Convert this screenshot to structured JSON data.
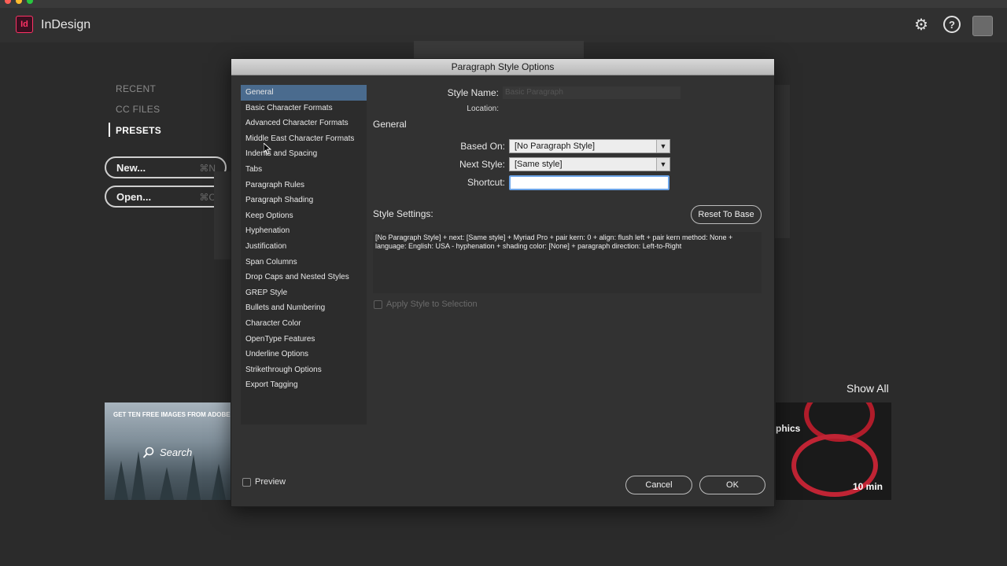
{
  "app": {
    "name": "InDesign",
    "logo": "Id"
  },
  "start": {
    "nav": {
      "recent": "RECENT",
      "cc_files": "CC FILES",
      "presets": "PRESETS"
    },
    "new_label": "New...",
    "new_key": "⌘N",
    "open_label": "Open...",
    "open_key": "⌘C",
    "show_all": "Show All",
    "tile_left_caption": "GET TEN FREE IMAGES FROM ADOBE ST",
    "tile_left_search": "Search",
    "tile_right_text": "phics",
    "tile_right_time": "10 min"
  },
  "dialog": {
    "title": "Paragraph Style Options",
    "categories": [
      "General",
      "Basic Character Formats",
      "Advanced Character Formats",
      "Middle East Character Formats",
      "Indents and Spacing",
      "Tabs",
      "Paragraph Rules",
      "Paragraph Shading",
      "Keep Options",
      "Hyphenation",
      "Justification",
      "Span Columns",
      "Drop Caps and Nested Styles",
      "GREP Style",
      "Bullets and Numbering",
      "Character Color",
      "OpenType Features",
      "Underline Options",
      "Strikethrough Options",
      "Export Tagging"
    ],
    "style_name_label": "Style Name:",
    "style_name_value": "Basic Paragraph",
    "location_label": "Location:",
    "section_title": "General",
    "based_on_label": "Based On:",
    "based_on_value": "[No Paragraph Style]",
    "next_style_label": "Next Style:",
    "next_style_value": "[Same style]",
    "shortcut_label": "Shortcut:",
    "shortcut_value": "",
    "style_settings_label": "Style Settings:",
    "reset_label": "Reset To Base",
    "settings_text": "[No Paragraph Style] + next: [Same style] + Myriad Pro + pair kern: 0 + align: flush left + pair kern method: None + language: English: USA - hyphenation + shading color: [None] + paragraph direction: Left-to-Right",
    "apply_label": "Apply Style to Selection",
    "preview_label": "Preview",
    "cancel_label": "Cancel",
    "ok_label": "OK"
  },
  "colors": {
    "accent_selected": "#4a6b8e",
    "focus_ring": "#6ba4e8",
    "logo": "#ff3366"
  },
  "icons": {
    "settings": "gear-icon",
    "help": "help-icon"
  }
}
